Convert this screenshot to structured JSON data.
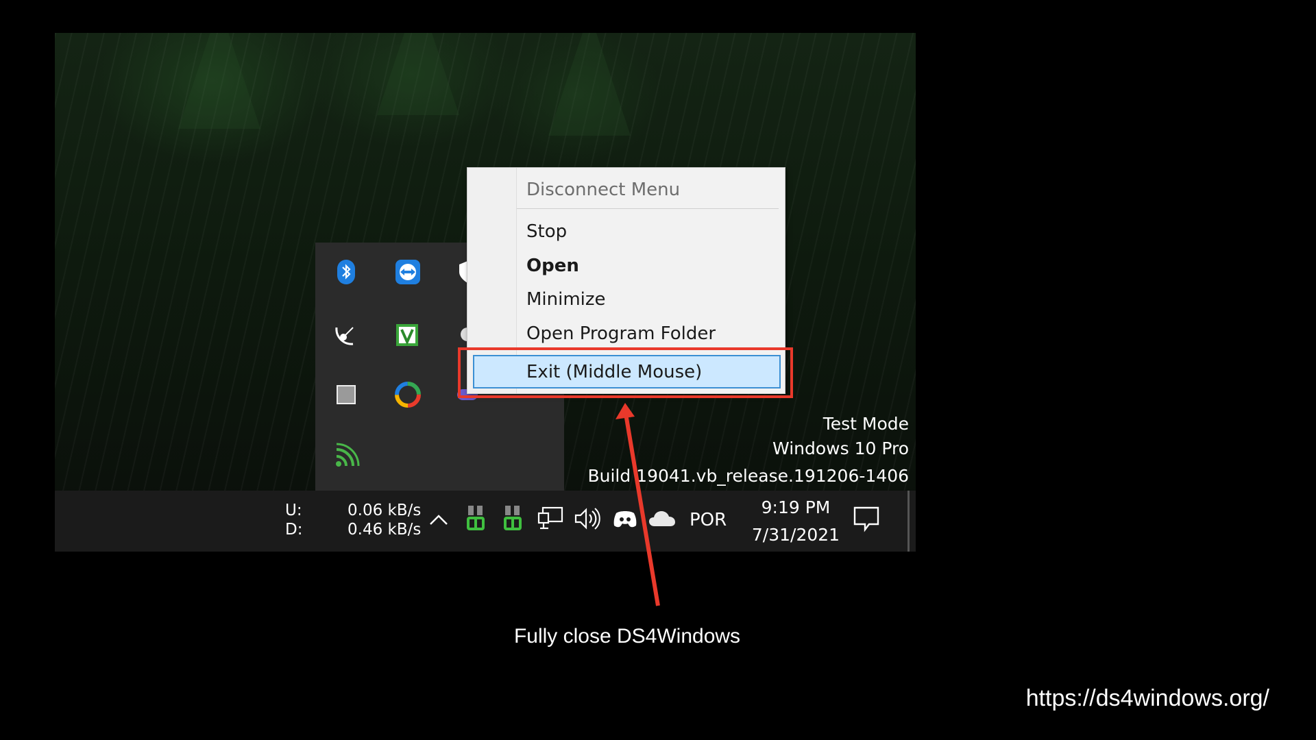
{
  "context_menu": {
    "items": [
      {
        "label": "Disconnect Menu",
        "state": "disabled"
      },
      {
        "label": "Stop"
      },
      {
        "label": "Open",
        "state": "default"
      },
      {
        "label": "Minimize"
      },
      {
        "label": "Open Program Folder"
      },
      {
        "label": "Exit (Middle Mouse)",
        "state": "hovered"
      }
    ]
  },
  "watermark": {
    "line1": "Test Mode",
    "line2": "Windows 10 Pro",
    "line3": "Build 19041.vb_release.191206-1406"
  },
  "taskbar": {
    "net_upload_label": "U:",
    "net_download_label": "D:",
    "net_upload_value": "0.06 kB/s",
    "net_download_value": "0.46 kB/s",
    "language": "POR",
    "time": "9:19 PM",
    "date": "7/31/2021"
  },
  "tray_icons": [
    "bluetooth-icon",
    "teamviewer-icon",
    "shield-icon",
    "satellite-icon",
    "v-app-icon",
    "app-icon",
    "square-icon",
    "color-wheel-icon",
    "gamepad-icon",
    "wireless-icon"
  ],
  "taskbar_icons": [
    "chevron-up-icon",
    "ds4-controller-icon",
    "ds4-controller-icon",
    "network-icon",
    "volume-icon",
    "discord-icon",
    "onedrive-icon",
    "notification-icon"
  ],
  "annotation": {
    "caption": "Fully close DS4Windows",
    "color": "#e9392b"
  },
  "footer": {
    "url": "https://ds4windows.org/"
  }
}
